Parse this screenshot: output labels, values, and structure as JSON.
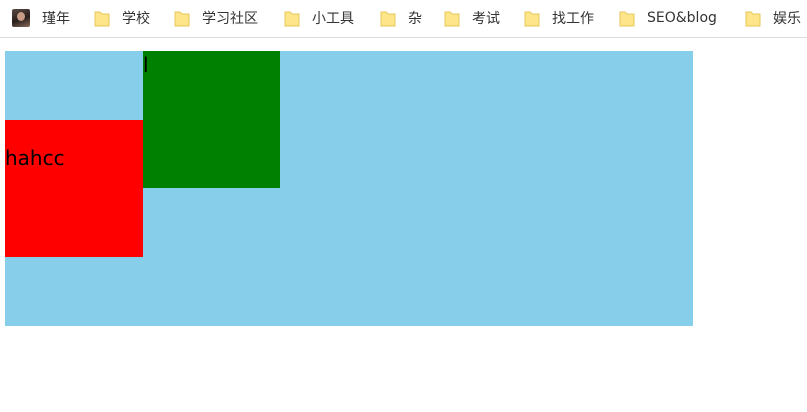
{
  "bookmarks": {
    "items": [
      {
        "label": "瑾年",
        "icon": "avatar-icon"
      },
      {
        "label": "学校",
        "icon": "folder-icon"
      },
      {
        "label": "学习社区",
        "icon": "folder-icon"
      },
      {
        "label": "小工具",
        "icon": "folder-icon"
      },
      {
        "label": "杂",
        "icon": "folder-icon"
      },
      {
        "label": "考试",
        "icon": "folder-icon"
      },
      {
        "label": "找工作",
        "icon": "folder-icon"
      },
      {
        "label": "SEO&blog",
        "icon": "folder-icon"
      },
      {
        "label": "娱乐",
        "icon": "folder-icon"
      }
    ]
  },
  "page": {
    "outer_box_color": "#87ceeb",
    "green_box": {
      "color": "#008000",
      "text": "l"
    },
    "red_box": {
      "color": "#ff0000",
      "text": "hahcc"
    }
  }
}
